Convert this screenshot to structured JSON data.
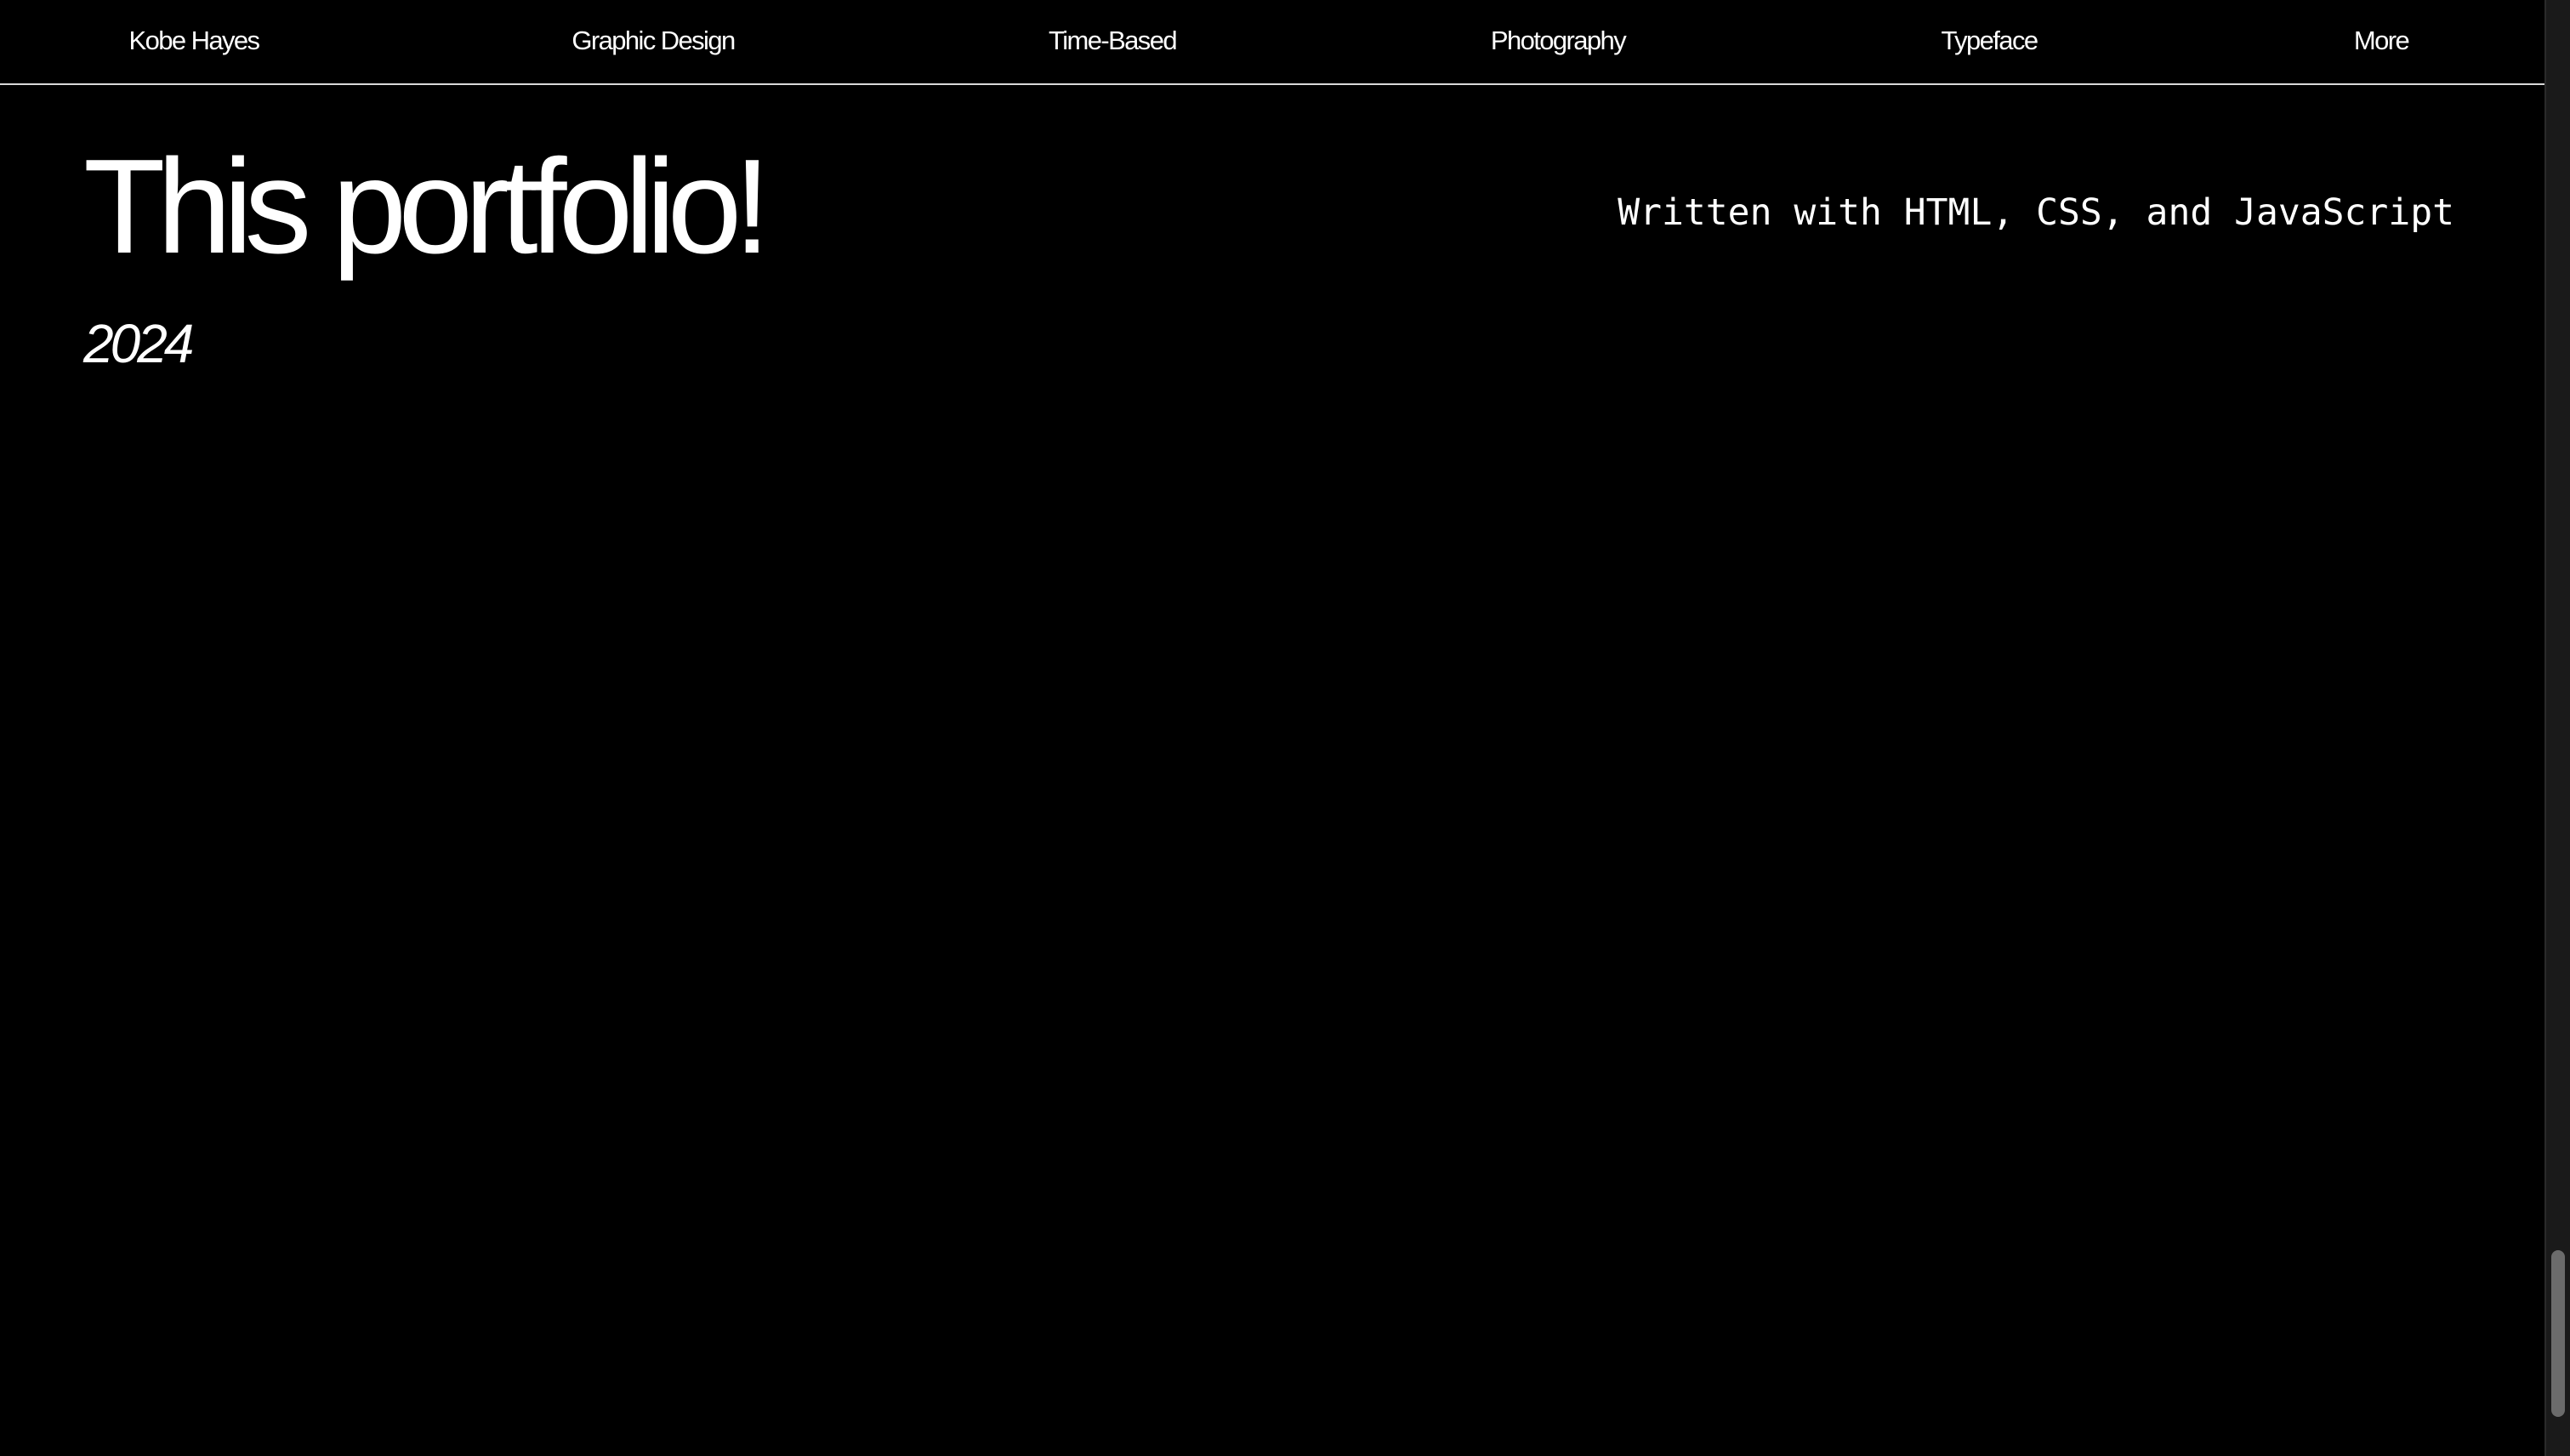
{
  "nav": {
    "brand": "Kobe Hayes",
    "items": [
      {
        "label": "Graphic Design"
      },
      {
        "label": "Time-Based"
      },
      {
        "label": "Photography"
      },
      {
        "label": "Typeface"
      },
      {
        "label": "More"
      }
    ]
  },
  "project": {
    "title": "This portfolio!",
    "tech": "Written with HTML, CSS, and JavaScript",
    "year": "2024"
  },
  "scrollbar": {
    "position": 0.87
  },
  "colors": {
    "background": "#000000",
    "text": "#ffffff",
    "divider": "#d9d9d9"
  }
}
